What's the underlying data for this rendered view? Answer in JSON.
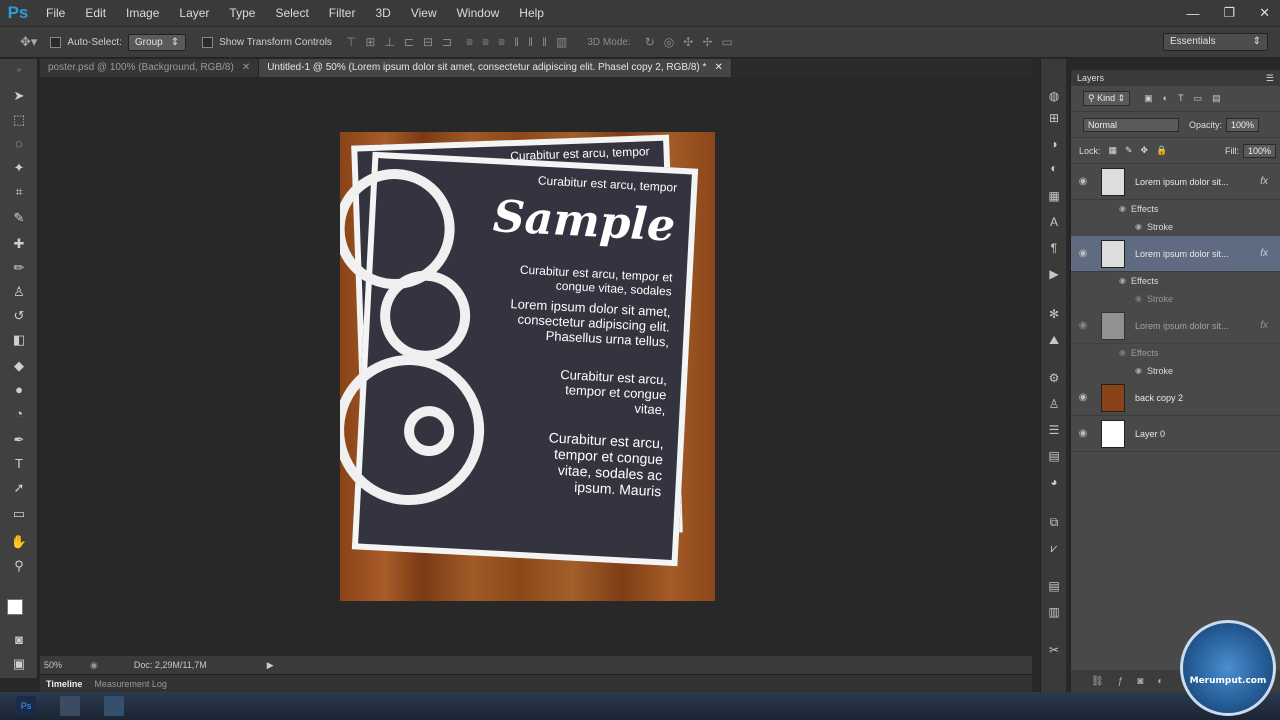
{
  "app": {
    "logo": "Ps"
  },
  "menu": [
    "File",
    "Edit",
    "Image",
    "Layer",
    "Type",
    "Select",
    "Filter",
    "3D",
    "View",
    "Window",
    "Help"
  ],
  "window_controls": [
    "—",
    "❐",
    "✕"
  ],
  "options": {
    "auto_select_label": "Auto-Select:",
    "auto_select_value": "Group",
    "show_transform_label": "Show Transform Controls",
    "mode_3d_label": "3D Mode:",
    "workspace": "Essentials"
  },
  "tabs": [
    {
      "label": "poster.psd @ 100% (Background, RGB/8)",
      "active": false
    },
    {
      "label": "Untitled-1 @ 50% (Lorem ipsum dolor sit amet, consectetur adipiscing elit. Phasel copy 2, RGB/8) *",
      "active": true
    }
  ],
  "canvas": {
    "back_heading": "Curabitur est arcu, tempor",
    "heading": "Curabitur est arcu, tempor",
    "title": "Sample",
    "para1": "Curabitur est arcu, tempor et congue vitae, sodales",
    "para2": "Lorem ipsum dolor sit amet, consectetur adipiscing elit. Phasellus urna tellus,",
    "para3": "Curabitur est arcu, tempor et congue vitae,",
    "para4": "Curabitur est arcu, tempor et congue vitae, sodales ac ipsum. Mauris"
  },
  "status": {
    "zoom": "50%",
    "doc": "Doc: 2,29M/11,7M"
  },
  "bottom_tabs": [
    "Timeline",
    "Measurement Log"
  ],
  "layers_panel": {
    "title": "Layers",
    "kind": "Kind",
    "blend_mode": "Normal",
    "opacity_label": "Opacity:",
    "opacity_value": "100%",
    "lock_label": "Lock:",
    "fill_label": "Fill:",
    "fill_value": "100%",
    "layers": [
      {
        "name": "Lorem ipsum dolor sit...",
        "fx": "fx",
        "effects": "Effects",
        "stroke": "Stroke"
      },
      {
        "name": "Lorem ipsum dolor sit...",
        "fx": "fx",
        "effects": "Effects",
        "stroke": "Stroke"
      },
      {
        "name": "Lorem ipsum dolor sit...",
        "fx": "fx",
        "effects": "Effects",
        "stroke": "Stroke"
      },
      {
        "name": "back copy 2"
      },
      {
        "name": "Layer 0"
      }
    ]
  },
  "watermark": "Merumput.com"
}
